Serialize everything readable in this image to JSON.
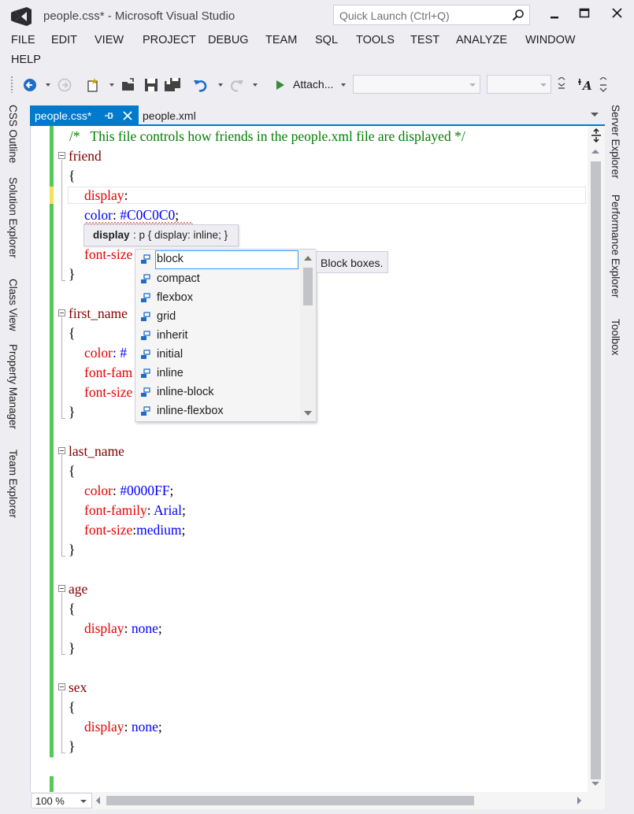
{
  "window": {
    "title": "people.css* - Microsoft Visual Studio",
    "quick_launch_placeholder": "Quick Launch (Ctrl+Q)"
  },
  "menu": [
    "FILE",
    "EDIT",
    "VIEW",
    "PROJECT",
    "DEBUG",
    "TEAM",
    "SQL",
    "TOOLS",
    "TEST",
    "ANALYZE",
    "WINDOW",
    "HELP"
  ],
  "toolbar": {
    "attach_label": "Attach...",
    "config_value": "",
    "platform_value": ""
  },
  "left_panels": [
    "CSS Outline",
    "Solution Explorer",
    "Class View",
    "Property Manager",
    "Team Explorer"
  ],
  "right_panels": [
    "Server Explorer",
    "Performance Explorer",
    "Toolbox"
  ],
  "tabs": {
    "active": "people.css*",
    "inactive": "people.xml"
  },
  "editor": {
    "comment": "/*   This file controls how friends in the people.xml file are displayed */",
    "blocks": [
      {
        "selector": "friend",
        "open": "{",
        "rules": [
          {
            "prop": "display",
            "sep": ":",
            "value": ""
          },
          {
            "prop": "color",
            "sep": ": ",
            "value": "#C0C0C0",
            "end": ";"
          },
          {
            "prop": "font-size",
            "sep": "",
            "value": "",
            "end": ""
          }
        ],
        "close": "}"
      },
      {
        "selector": "first_name",
        "open": "{",
        "rules": [
          {
            "prop": "color",
            "sep": ": #",
            "value": ""
          },
          {
            "prop": "font-fam",
            "sep": "",
            "value": ""
          },
          {
            "prop": "font-size",
            "sep": "",
            "value": ""
          }
        ],
        "close": "}"
      },
      {
        "selector": "last_name",
        "open": "{",
        "rules": [
          {
            "prop": "color",
            "sep": ": ",
            "value": "#0000FF",
            "end": ";"
          },
          {
            "prop": "font-family",
            "sep": ": ",
            "value": "Arial",
            "end": ";"
          },
          {
            "prop": "font-size",
            "sep": ":",
            "value": "medium",
            "end": ";"
          }
        ],
        "close": "}"
      },
      {
        "selector": "age",
        "open": "{",
        "rules": [
          {
            "prop": "display",
            "sep": ": ",
            "value": "none",
            "end": ";"
          }
        ],
        "close": "}"
      },
      {
        "selector": "sex",
        "open": "{",
        "rules": [
          {
            "prop": "display",
            "sep": ": ",
            "value": "none",
            "end": ";"
          }
        ],
        "close": "}"
      }
    ]
  },
  "tooltip": {
    "name": "display",
    "rest": ": p { display: inline; }"
  },
  "completion": {
    "items": [
      "block",
      "compact",
      "flexbox",
      "grid",
      "inherit",
      "initial",
      "inline",
      "inline-block",
      "inline-flexbox"
    ],
    "selected": "block",
    "description": "Block boxes."
  },
  "status": {
    "zoom": "100 %"
  },
  "colors": {
    "accent": "#007acc",
    "change_saved": "#57c95a",
    "change_unsaved": "#f2e15a",
    "selector": "#800000",
    "property": "#e50000",
    "value": "#0000ff",
    "comment": "#008000"
  }
}
